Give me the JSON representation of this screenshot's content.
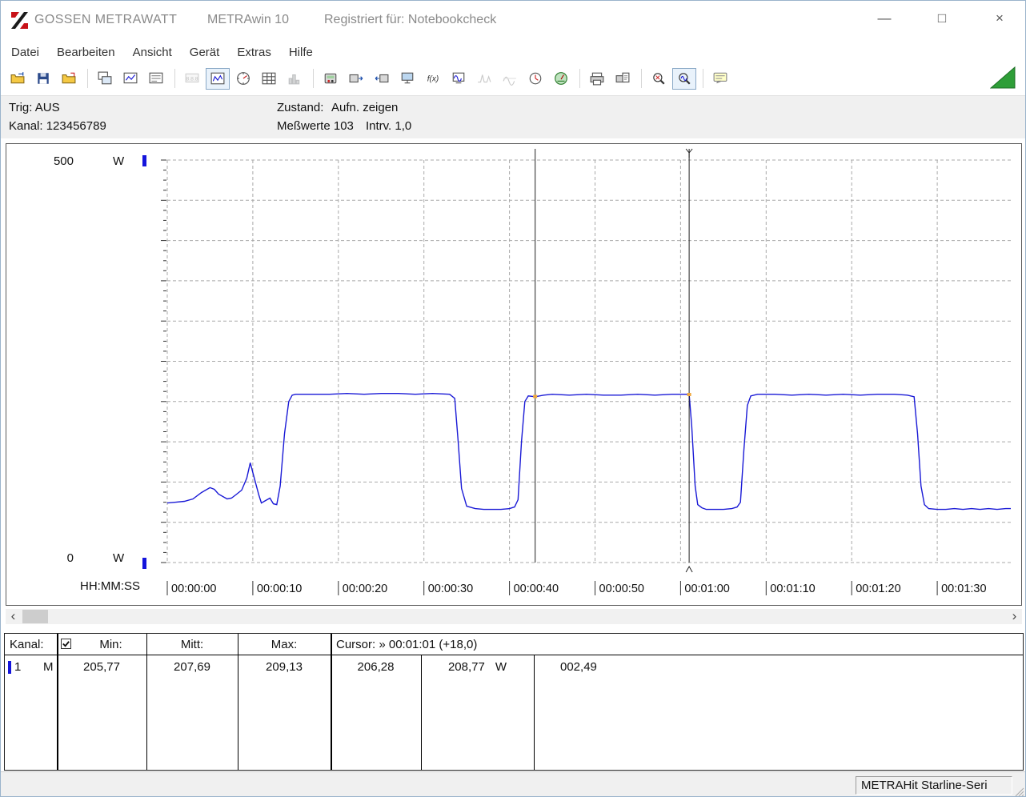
{
  "window": {
    "brand": "GOSSEN METRAWATT",
    "app": "METRAwin 10",
    "registration": "Registriert für: Notebookcheck",
    "controls": {
      "minimize": "—",
      "maximize": "□",
      "close": "×"
    }
  },
  "menu": {
    "items": [
      "Datei",
      "Bearbeiten",
      "Ansicht",
      "Gerät",
      "Extras",
      "Hilfe"
    ]
  },
  "toolbar": {
    "buttons": [
      {
        "name": "open-file"
      },
      {
        "name": "save"
      },
      {
        "name": "export-file"
      },
      {
        "sep": true
      },
      {
        "name": "copy-window"
      },
      {
        "name": "copy-chart"
      },
      {
        "name": "copy-data"
      },
      {
        "sep": true
      },
      {
        "name": "numeric-display",
        "state": "disabled"
      },
      {
        "name": "line-chart",
        "state": "pressed"
      },
      {
        "name": "gauge"
      },
      {
        "name": "table-display"
      },
      {
        "name": "bar-display",
        "state": "disabled"
      },
      {
        "sep": true
      },
      {
        "name": "device-settings"
      },
      {
        "name": "device-upload"
      },
      {
        "name": "device-download"
      },
      {
        "name": "pc-transfer"
      },
      {
        "name": "formula-fx"
      },
      {
        "name": "device-monitor"
      },
      {
        "name": "signal-min",
        "state": "disabled"
      },
      {
        "name": "signal-envelope",
        "state": "disabled"
      },
      {
        "name": "channel-clock"
      },
      {
        "name": "meter-online"
      },
      {
        "sep": true
      },
      {
        "name": "print"
      },
      {
        "name": "print-preview"
      },
      {
        "sep": true
      },
      {
        "name": "zoom-in"
      },
      {
        "name": "zoom-curve",
        "state": "pressed"
      },
      {
        "sep": true
      },
      {
        "name": "annotation"
      }
    ]
  },
  "status_panel": {
    "trig": "Trig: AUS",
    "kanal": "Kanal: 123456789",
    "zustand_label": "Zustand:",
    "zustand_value": "Aufn. zeigen",
    "messwerte": "Meßwerte 103",
    "interval": "Intrv. 1,0"
  },
  "chart_data": {
    "type": "line",
    "title": "",
    "x_axis_label": "HH:MM:SS",
    "y_axis": {
      "max": "500",
      "min": "0",
      "unit": "W"
    },
    "ylim": [
      0,
      500
    ],
    "grid_step_y": 50,
    "grid": true,
    "x_ticks": [
      "00:00:00",
      "00:00:10",
      "00:00:20",
      "00:00:30",
      "00:00:40",
      "00:00:50",
      "00:01:00",
      "00:01:10",
      "00:01:20",
      "00:01:30"
    ],
    "x_tick_seconds": [
      0,
      10,
      20,
      30,
      40,
      50,
      60,
      70,
      80,
      90
    ],
    "series": [
      {
        "name": "Kanal 1 (M)",
        "unit": "W",
        "color": "#1a1ad6",
        "points": [
          [
            0,
            74
          ],
          [
            1,
            75
          ],
          [
            2,
            76
          ],
          [
            3,
            79
          ],
          [
            4,
            87
          ],
          [
            5,
            93
          ],
          [
            5.5,
            91
          ],
          [
            6,
            85
          ],
          [
            7,
            79
          ],
          [
            7.5,
            80
          ],
          [
            8,
            84
          ],
          [
            8.7,
            90
          ],
          [
            9.3,
            105
          ],
          [
            9.7,
            124
          ],
          [
            10.2,
            104
          ],
          [
            10.7,
            84
          ],
          [
            11,
            74
          ],
          [
            11.5,
            77
          ],
          [
            12,
            80
          ],
          [
            12.4,
            73
          ],
          [
            12.8,
            72
          ],
          [
            13.2,
            95
          ],
          [
            13.7,
            160
          ],
          [
            14.2,
            200
          ],
          [
            14.6,
            208
          ],
          [
            15,
            209
          ],
          [
            17,
            209
          ],
          [
            19,
            209
          ],
          [
            21,
            210
          ],
          [
            23,
            209
          ],
          [
            25,
            210
          ],
          [
            27,
            210
          ],
          [
            29,
            209
          ],
          [
            31,
            210
          ],
          [
            33,
            209
          ],
          [
            33.6,
            204
          ],
          [
            34,
            150
          ],
          [
            34.4,
            92
          ],
          [
            35,
            70
          ],
          [
            36,
            67
          ],
          [
            37,
            66
          ],
          [
            38,
            66
          ],
          [
            39,
            66
          ],
          [
            40,
            67
          ],
          [
            40.6,
            69
          ],
          [
            41,
            78
          ],
          [
            41.4,
            150
          ],
          [
            41.8,
            200
          ],
          [
            42.2,
            207
          ],
          [
            43,
            206
          ],
          [
            44,
            208
          ],
          [
            45,
            209
          ],
          [
            47,
            208
          ],
          [
            49,
            209
          ],
          [
            51,
            208
          ],
          [
            53,
            208
          ],
          [
            55,
            209
          ],
          [
            57,
            208
          ],
          [
            59,
            209
          ],
          [
            60.5,
            209
          ],
          [
            61,
            209
          ],
          [
            61.3,
            170
          ],
          [
            61.7,
            95
          ],
          [
            62,
            72
          ],
          [
            62.5,
            68
          ],
          [
            63,
            66
          ],
          [
            64,
            66
          ],
          [
            65,
            66
          ],
          [
            66,
            67
          ],
          [
            66.6,
            69
          ],
          [
            67,
            75
          ],
          [
            67.4,
            140
          ],
          [
            67.8,
            195
          ],
          [
            68.2,
            207
          ],
          [
            69,
            209
          ],
          [
            71,
            209
          ],
          [
            73,
            208
          ],
          [
            75,
            209
          ],
          [
            77,
            208
          ],
          [
            79,
            209
          ],
          [
            81,
            208
          ],
          [
            83,
            209
          ],
          [
            85,
            209
          ],
          [
            86.5,
            208
          ],
          [
            87.3,
            206
          ],
          [
            87.7,
            160
          ],
          [
            88.1,
            95
          ],
          [
            88.5,
            72
          ],
          [
            89,
            67
          ],
          [
            90,
            66
          ],
          [
            91,
            66
          ],
          [
            92,
            67
          ],
          [
            93,
            66
          ],
          [
            94,
            67
          ],
          [
            95,
            66
          ],
          [
            96,
            67
          ],
          [
            97,
            66
          ],
          [
            98,
            67
          ],
          [
            98.6,
            67
          ]
        ]
      }
    ],
    "cursors": [
      {
        "t": 43,
        "time": "00:00:43",
        "value": 206.28,
        "active": false
      },
      {
        "t": 61,
        "time": "00:01:01",
        "value": 208.77,
        "active": true
      }
    ]
  },
  "scrollbar": {
    "left": "‹",
    "right": "›"
  },
  "table": {
    "header": {
      "kanal": "Kanal:",
      "checkbox_checked": true,
      "min": "Min:",
      "mitt": "Mitt:",
      "max": "Max:",
      "cursor": "Cursor: » 00:01:01 (+18,0)"
    },
    "row": {
      "channel": "1",
      "type": "M",
      "min": "205,77",
      "mitt": "207,69",
      "max": "209,13",
      "cursor_a": "206,28",
      "cursor_b": "208,77",
      "unit": "W",
      "delta": "002,49"
    }
  },
  "statusbar": {
    "device": "METRAHit Starline-Seri"
  }
}
